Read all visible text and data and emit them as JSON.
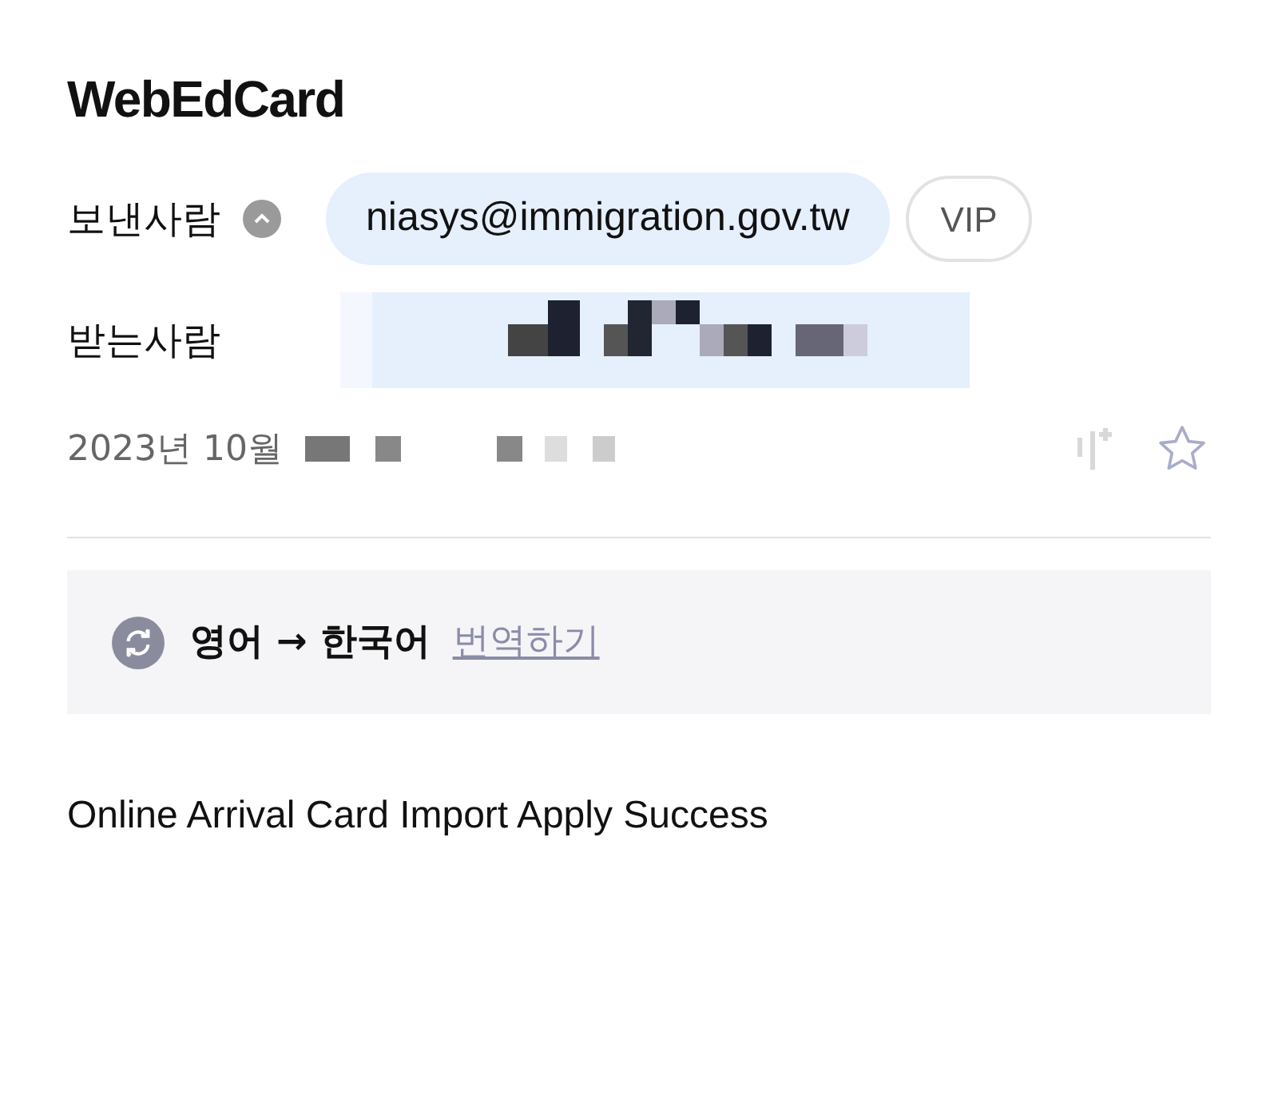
{
  "title": "WebEdCard",
  "sender": {
    "label": "보낸사람",
    "address": "niasys@immigration.gov.tw",
    "badge": "VIP",
    "expanded": true
  },
  "recipient": {
    "label": "받는사람"
  },
  "date": {
    "text": "2023년 10월",
    "starred": false
  },
  "translation": {
    "languages": "영어 → 한국어",
    "link": "번역하기"
  },
  "body": "Online Arrival Card Import Apply Success"
}
